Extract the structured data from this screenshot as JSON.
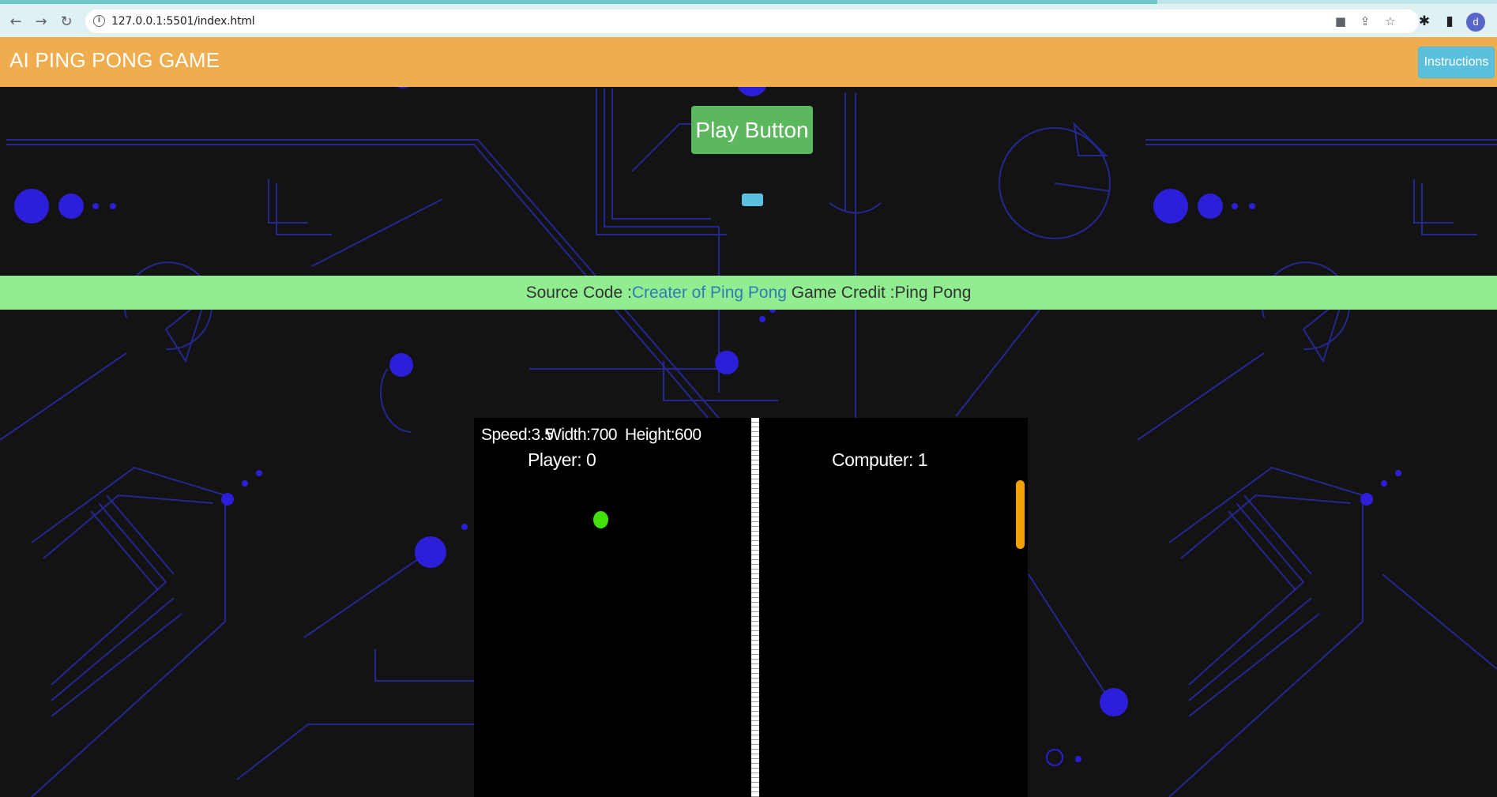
{
  "browser": {
    "url": "127.0.0.1:5501/index.html",
    "profile_initial": "d",
    "icons": {
      "back": "arrow-left-icon",
      "forward": "arrow-right-icon",
      "reload": "reload-icon",
      "info": "info-icon",
      "camera": "camera-icon",
      "share": "share-icon",
      "bookmark": "star-icon",
      "extensions": "puzzle-icon",
      "side_panel": "side-panel-icon"
    }
  },
  "header": {
    "title": "AI PING PONG GAME",
    "instructions_label": "Instructions",
    "background_color": "#f0ad4e"
  },
  "play_button_label": "Play Button",
  "credits": {
    "source_prefix": "Source Code :",
    "source_link": "Creater of Ping Pong",
    "game_credit": " Game Credit :Ping Pong"
  },
  "game": {
    "speed_text": "Speed:3.5",
    "width_text": "Width:700",
    "height_text": "Height:600",
    "player_label": "Player: 0",
    "computer_label": "Computer: 1",
    "ball_color": "#43e10a",
    "paddle_color": "#f4a007"
  },
  "colors": {
    "instructions": "#5bc0de",
    "play": "#5cb85c",
    "credit_bar": "#90ee90",
    "link": "#337ab7"
  }
}
